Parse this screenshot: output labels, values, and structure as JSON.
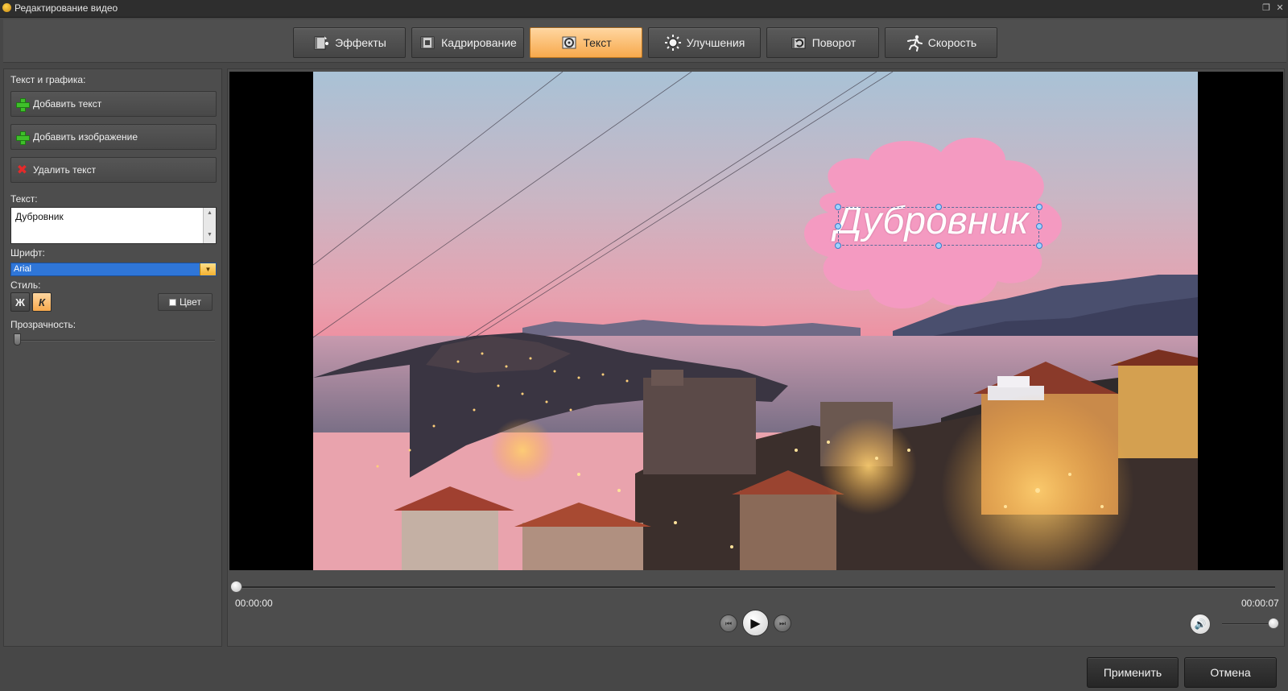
{
  "window": {
    "title": "Редактирование видео",
    "controls": [
      "restore-icon",
      "close-icon"
    ]
  },
  "tabs": [
    {
      "label": "Эффекты",
      "icon": "effects-icon",
      "active": false
    },
    {
      "label": "Кадрирование",
      "icon": "crop-icon",
      "active": false
    },
    {
      "label": "Текст",
      "icon": "text-icon",
      "active": true
    },
    {
      "label": "Улучшения",
      "icon": "brightness-icon",
      "active": false
    },
    {
      "label": "Поворот",
      "icon": "rotate-icon",
      "active": false
    },
    {
      "label": "Скорость",
      "icon": "speed-icon",
      "active": false
    }
  ],
  "left_panel": {
    "section_title": "Текст и графика:",
    "add_text": "Добавить текст",
    "add_image": "Добавить изображение",
    "delete_text": "Удалить текст",
    "text_label": "Текст:",
    "text_value": "Дубровник",
    "font_label": "Шрифт:",
    "font_value": "Arial",
    "style_label": "Стиль:",
    "bold_label": "Ж",
    "italic_label": "К",
    "italic_active": true,
    "color_label": "Цвет",
    "color_swatch": "#ffffff",
    "opacity_label": "Прозрачность:",
    "opacity_value": 0
  },
  "preview": {
    "overlay_text": "Дубровник",
    "cloud_color": "#f49ac1",
    "text_color": "#ffffff"
  },
  "transport": {
    "current_time": "00:00:00",
    "total_time": "00:00:07",
    "position": 0,
    "volume": 1
  },
  "footer": {
    "apply": "Применить",
    "cancel": "Отмена"
  }
}
